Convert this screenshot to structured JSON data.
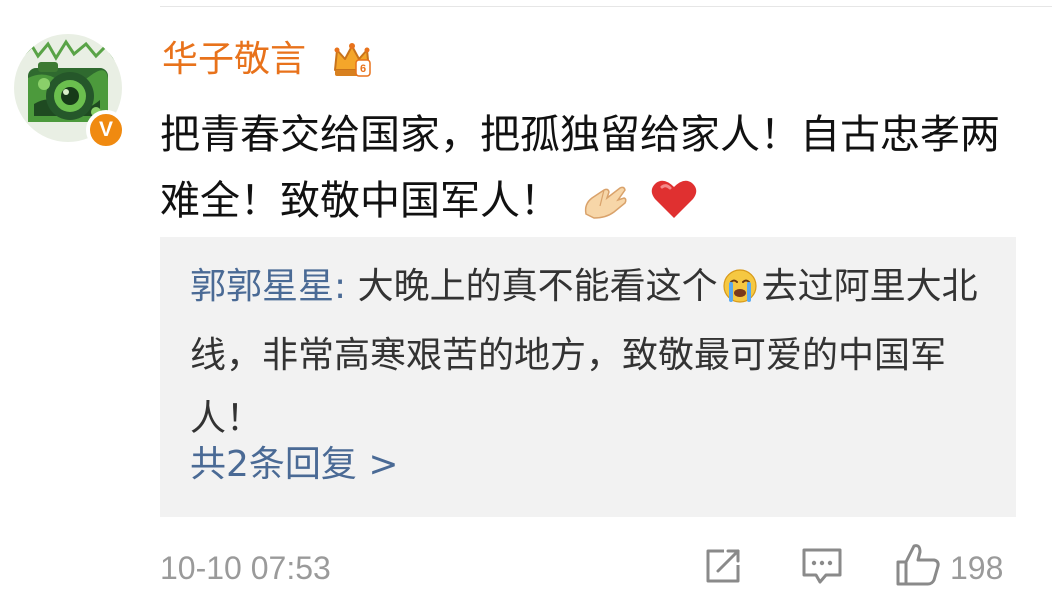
{
  "comment": {
    "author": "华子敬言",
    "text": "把青春交给国家，把孤独留给家人！自古忠孝两难全！致敬中国军人！",
    "emojis": [
      "folded-hands-emoji",
      "red-heart-emoji"
    ],
    "verified_badge": "V",
    "timestamp": "10-10 07:53",
    "like_count": "198"
  },
  "reply": {
    "author": "郭郭星星:",
    "text_before_emoji": "大晚上的真不能看这个",
    "emoji": "crying-face-emoji",
    "text_after_emoji": "去过阿里大北线，非常高寒艰苦的地方，致敬最可爱的中国军人！",
    "more_replies": "共2条回复 >"
  },
  "colors": {
    "author_orange": "#e8721b",
    "reply_blue": "#4a6a95",
    "badge_orange": "#f08a10",
    "reply_bg": "#f2f2f2",
    "meta_gray": "#9a9a9a"
  },
  "icons": {
    "share": "share-icon",
    "comment": "comment-icon",
    "like": "thumbs-up-icon",
    "crown": "crown-badge-icon",
    "verified": "verified-v-badge"
  }
}
